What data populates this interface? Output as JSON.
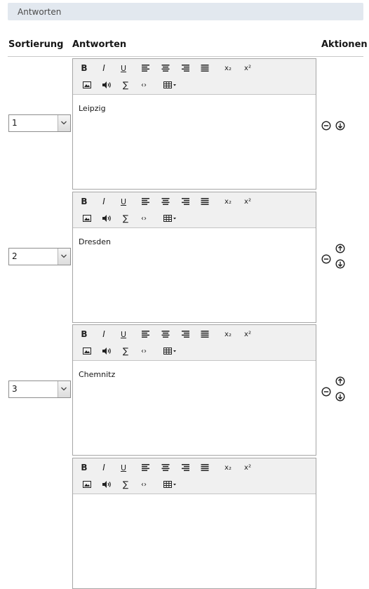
{
  "section": {
    "title": "Antworten"
  },
  "columns": {
    "sort": "Sortierung",
    "answers": "Antworten",
    "actions": "Aktionen"
  },
  "answers": [
    {
      "order": "1",
      "text": "Leipzig",
      "actions": [
        "remove",
        "move-down"
      ]
    },
    {
      "order": "2",
      "text": "Dresden",
      "actions": [
        "remove",
        "move-up",
        "move-down"
      ]
    },
    {
      "order": "3",
      "text": "Chemnitz",
      "actions": [
        "remove",
        "move-up",
        "move-down"
      ]
    },
    {
      "order": "",
      "text": "",
      "actions": []
    }
  ],
  "toolbar": {
    "bold": "B",
    "italic": "I",
    "underline": "U",
    "sum": "∑",
    "code": "‹›",
    "subscript": "x₂",
    "superscript": "x²"
  }
}
